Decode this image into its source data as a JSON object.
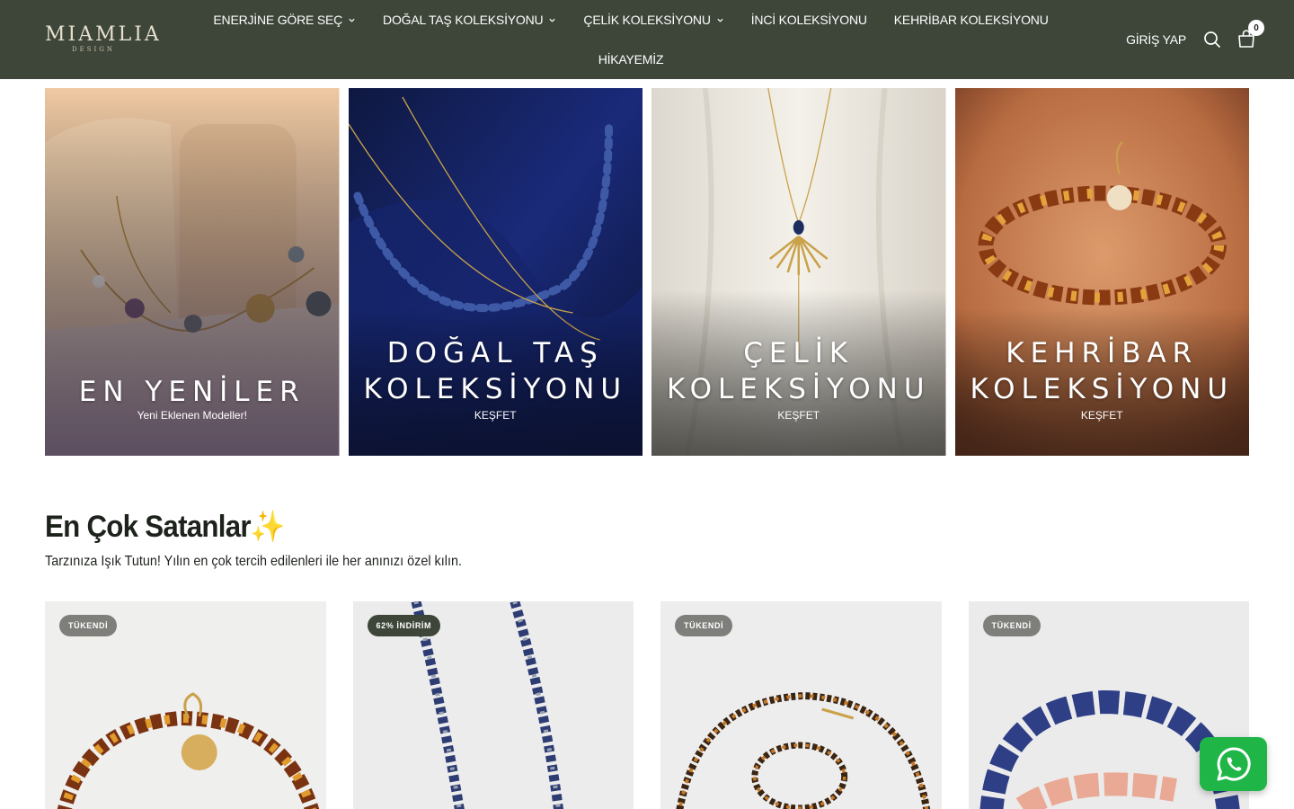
{
  "header": {
    "logo_text": "MIAMLIA",
    "logo_sub": "DESIGN",
    "nav_row1": [
      {
        "label": "ENERJİNE GÖRE SEÇ",
        "has_dropdown": true
      },
      {
        "label": "DOĞAL TAŞ KOLEKSİYONU",
        "has_dropdown": true
      },
      {
        "label": "ÇELİK KOLEKSİYONU",
        "has_dropdown": true
      },
      {
        "label": "İNCİ KOLEKSİYONU",
        "has_dropdown": false
      },
      {
        "label": "KEHRİBAR KOLEKSİYONU",
        "has_dropdown": false
      }
    ],
    "nav_row2": [
      {
        "label": "HİKAYEMİZ",
        "has_dropdown": false
      }
    ],
    "login_label": "GİRİŞ YAP",
    "search_icon": "search-icon",
    "cart_icon": "cart-icon",
    "cart_count": "0",
    "bg_color": "#3d4639"
  },
  "banners": [
    {
      "title_lines": [
        "EN YENİLER"
      ],
      "subtitle": "Yeni Eklenen Modeller!"
    },
    {
      "title_lines": [
        "DOĞAL TAŞ",
        "KOLEKSİYONU"
      ],
      "subtitle": "KEŞFET"
    },
    {
      "title_lines": [
        "ÇELİK",
        "KOLEKSİYONU"
      ],
      "subtitle": "KEŞFET"
    },
    {
      "title_lines": [
        "KEHRİBAR",
        "KOLEKSİYONU"
      ],
      "subtitle": "KEŞFET"
    }
  ],
  "section": {
    "title": "En Çok Satanlar✨",
    "subtitle": "Tarzınıza Işık Tutun! Yılın en çok tercih edilenleri ile her anınızı özel kılın."
  },
  "products": [
    {
      "badge": "TÜKENDİ",
      "badge_type": "sold"
    },
    {
      "badge": "62% İNDİRİM",
      "badge_type": "sale"
    },
    {
      "badge": "TÜKENDİ",
      "badge_type": "sold"
    },
    {
      "badge": "TÜKENDİ",
      "badge_type": "sold"
    }
  ],
  "whatsapp_icon": "whatsapp-icon"
}
